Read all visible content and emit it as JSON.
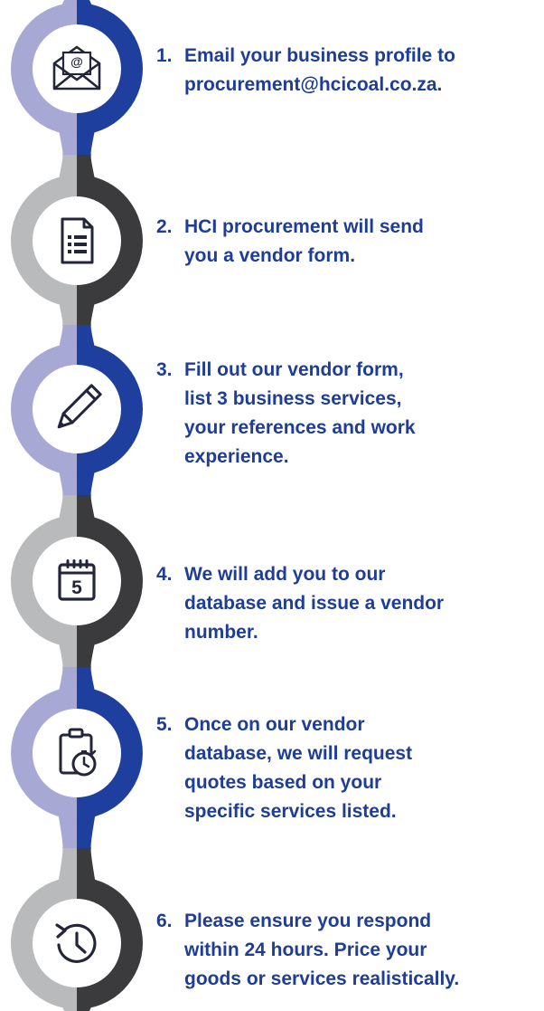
{
  "colors": {
    "blue_light": "#a7a9d4",
    "blue_dark": "#1e3f9d",
    "gray_light": "#b9babb",
    "gray_dark": "#3b3b3d",
    "text": "#1e3d96",
    "icon": "#23263a"
  },
  "steps": [
    {
      "number": "1.",
      "lines": [
        "Email your business profile to",
        "procurement@hcicoal.co.za."
      ],
      "icon": "email-envelope-icon",
      "scheme": "blue"
    },
    {
      "number": "2.",
      "lines": [
        "HCI procurement will send",
        "you a vendor form."
      ],
      "icon": "document-form-icon",
      "scheme": "gray"
    },
    {
      "number": "3.",
      "lines": [
        "Fill out our vendor form,",
        "list 3 business services,",
        "your references and work",
        "experience."
      ],
      "icon": "pencil-icon",
      "scheme": "blue"
    },
    {
      "number": "4.",
      "lines": [
        "We will add you to our",
        "database and issue a vendor",
        "number."
      ],
      "icon": "calendar-icon",
      "scheme": "gray",
      "icon_text": "5"
    },
    {
      "number": "5.",
      "lines": [
        "Once on our vendor",
        "database, we will request",
        "quotes based on your",
        "specific services listed."
      ],
      "icon": "clipboard-timer-icon",
      "scheme": "blue"
    },
    {
      "number": "6.",
      "lines": [
        "Please ensure you respond",
        "within 24 hours. Price your",
        "goods or services realistically."
      ],
      "icon": "clock-history-icon",
      "scheme": "gray"
    }
  ]
}
